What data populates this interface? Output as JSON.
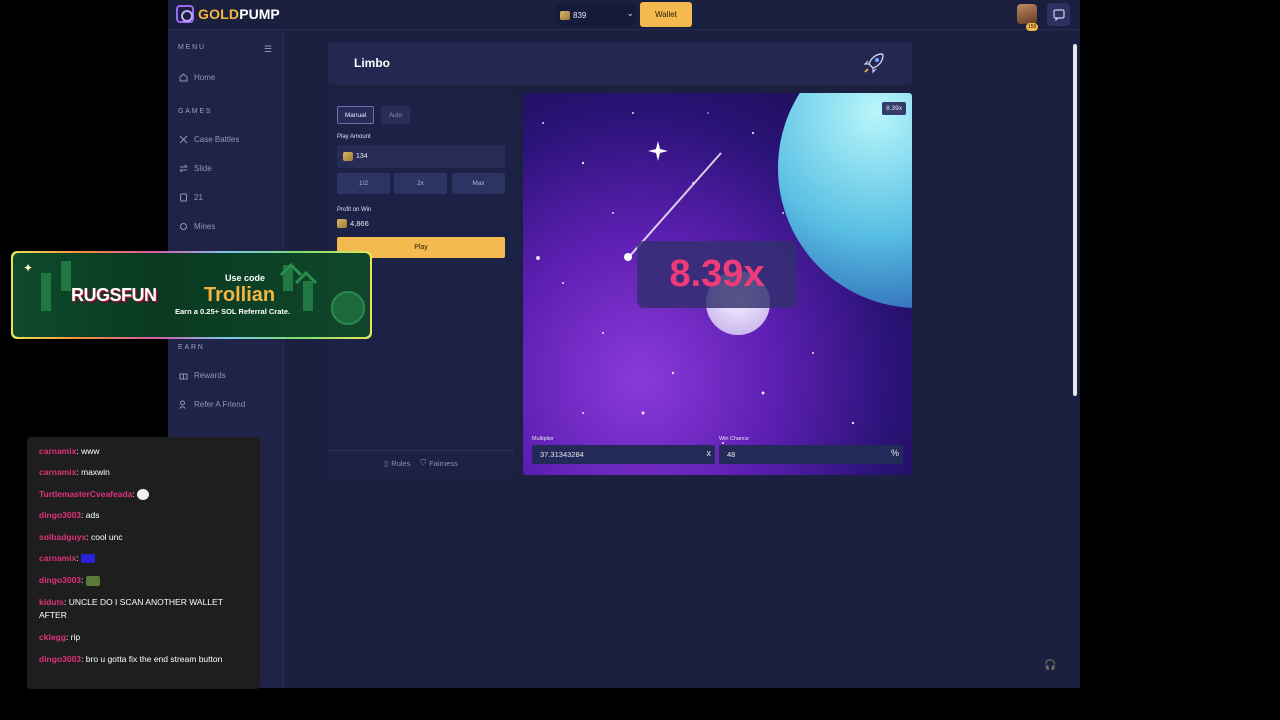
{
  "brand": {
    "gold": "GOLD",
    "pump": "PUMP"
  },
  "topbar": {
    "balance": "839",
    "wallet_label": "Wallet",
    "avatar_badge": "150"
  },
  "sidebar": {
    "menu_heading": "MENU",
    "home": "Home",
    "games_heading": "GAMES",
    "games": [
      "Case Battles",
      "Slide",
      "21",
      "Mines"
    ],
    "earn_heading": "EARN",
    "earn": [
      "Rewards",
      "Refer A Friend"
    ]
  },
  "game": {
    "title": "Limbo",
    "mode_manual": "Manual",
    "mode_auto": "Auto",
    "play_amount_label": "Play Amount",
    "play_amount": "134",
    "half_label": "1/2",
    "double_label": "2x",
    "max_label": "Max",
    "profit_label": "Profit on Win",
    "profit_value": "4,866",
    "play_label": "Play",
    "rules_label": "Rules",
    "fairness_label": "Fairness",
    "last_result_badge": "8.39x",
    "result": "8.39x",
    "multiplier_label": "Multiplier",
    "multiplier_value": "37.31343284",
    "multiplier_suffix": "x",
    "win_chance_label": "Win Chance",
    "win_chance_value": "48",
    "win_chance_suffix": "%"
  },
  "promo": {
    "logo_text": "RUGSFUN",
    "use_code": "Use code",
    "code": "Trollian",
    "subtitle": "Earn a 0.25+ SOL Referral Crate."
  },
  "chat": [
    {
      "user": "carnamix",
      "text": "www",
      "color": "#e0327a"
    },
    {
      "user": "carnamix",
      "text": "maxwin",
      "color": "#e0327a"
    },
    {
      "user": "TurtlemasterCveafeada",
      "text": "",
      "color": "#e0327a"
    },
    {
      "user": "dingo3003",
      "text": "ads",
      "color": "#e0327a"
    },
    {
      "user": "solbadguyx",
      "text": "cool unc",
      "color": "#e0327a"
    },
    {
      "user": "carnamix",
      "text": "",
      "color": "#e0327a"
    },
    {
      "user": "dingo3003",
      "text": "",
      "color": "#e0327a"
    },
    {
      "user": "kiduts",
      "text": "UNCLE DO I SCAN ANOTHER WALLET AFTER",
      "color": "#e0327a"
    },
    {
      "user": "cklegg",
      "text": "rip",
      "color": "#e0327a"
    },
    {
      "user": "dingo3003",
      "text": "bro u gotta fix the end stream button",
      "color": "#e0327a"
    }
  ],
  "colors": {
    "accent": "#f4b94f",
    "result": "#ef3b79",
    "bg": "#1c2040",
    "purple": "#9a6bf0"
  }
}
